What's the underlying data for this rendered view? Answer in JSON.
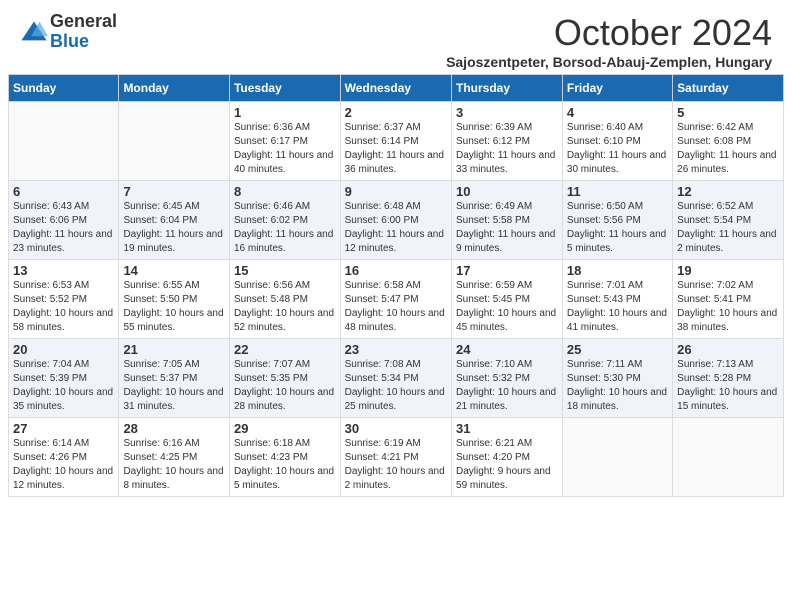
{
  "header": {
    "logo_general": "General",
    "logo_blue": "Blue",
    "month_title": "October 2024",
    "subtitle": "Sajoszentpeter, Borsod-Abauj-Zemplen, Hungary"
  },
  "days_of_week": [
    "Sunday",
    "Monday",
    "Tuesday",
    "Wednesday",
    "Thursday",
    "Friday",
    "Saturday"
  ],
  "weeks": [
    [
      {
        "day": "",
        "detail": ""
      },
      {
        "day": "",
        "detail": ""
      },
      {
        "day": "1",
        "detail": "Sunrise: 6:36 AM\nSunset: 6:17 PM\nDaylight: 11 hours and 40 minutes."
      },
      {
        "day": "2",
        "detail": "Sunrise: 6:37 AM\nSunset: 6:14 PM\nDaylight: 11 hours and 36 minutes."
      },
      {
        "day": "3",
        "detail": "Sunrise: 6:39 AM\nSunset: 6:12 PM\nDaylight: 11 hours and 33 minutes."
      },
      {
        "day": "4",
        "detail": "Sunrise: 6:40 AM\nSunset: 6:10 PM\nDaylight: 11 hours and 30 minutes."
      },
      {
        "day": "5",
        "detail": "Sunrise: 6:42 AM\nSunset: 6:08 PM\nDaylight: 11 hours and 26 minutes."
      }
    ],
    [
      {
        "day": "6",
        "detail": "Sunrise: 6:43 AM\nSunset: 6:06 PM\nDaylight: 11 hours and 23 minutes."
      },
      {
        "day": "7",
        "detail": "Sunrise: 6:45 AM\nSunset: 6:04 PM\nDaylight: 11 hours and 19 minutes."
      },
      {
        "day": "8",
        "detail": "Sunrise: 6:46 AM\nSunset: 6:02 PM\nDaylight: 11 hours and 16 minutes."
      },
      {
        "day": "9",
        "detail": "Sunrise: 6:48 AM\nSunset: 6:00 PM\nDaylight: 11 hours and 12 minutes."
      },
      {
        "day": "10",
        "detail": "Sunrise: 6:49 AM\nSunset: 5:58 PM\nDaylight: 11 hours and 9 minutes."
      },
      {
        "day": "11",
        "detail": "Sunrise: 6:50 AM\nSunset: 5:56 PM\nDaylight: 11 hours and 5 minutes."
      },
      {
        "day": "12",
        "detail": "Sunrise: 6:52 AM\nSunset: 5:54 PM\nDaylight: 11 hours and 2 minutes."
      }
    ],
    [
      {
        "day": "13",
        "detail": "Sunrise: 6:53 AM\nSunset: 5:52 PM\nDaylight: 10 hours and 58 minutes."
      },
      {
        "day": "14",
        "detail": "Sunrise: 6:55 AM\nSunset: 5:50 PM\nDaylight: 10 hours and 55 minutes."
      },
      {
        "day": "15",
        "detail": "Sunrise: 6:56 AM\nSunset: 5:48 PM\nDaylight: 10 hours and 52 minutes."
      },
      {
        "day": "16",
        "detail": "Sunrise: 6:58 AM\nSunset: 5:47 PM\nDaylight: 10 hours and 48 minutes."
      },
      {
        "day": "17",
        "detail": "Sunrise: 6:59 AM\nSunset: 5:45 PM\nDaylight: 10 hours and 45 minutes."
      },
      {
        "day": "18",
        "detail": "Sunrise: 7:01 AM\nSunset: 5:43 PM\nDaylight: 10 hours and 41 minutes."
      },
      {
        "day": "19",
        "detail": "Sunrise: 7:02 AM\nSunset: 5:41 PM\nDaylight: 10 hours and 38 minutes."
      }
    ],
    [
      {
        "day": "20",
        "detail": "Sunrise: 7:04 AM\nSunset: 5:39 PM\nDaylight: 10 hours and 35 minutes."
      },
      {
        "day": "21",
        "detail": "Sunrise: 7:05 AM\nSunset: 5:37 PM\nDaylight: 10 hours and 31 minutes."
      },
      {
        "day": "22",
        "detail": "Sunrise: 7:07 AM\nSunset: 5:35 PM\nDaylight: 10 hours and 28 minutes."
      },
      {
        "day": "23",
        "detail": "Sunrise: 7:08 AM\nSunset: 5:34 PM\nDaylight: 10 hours and 25 minutes."
      },
      {
        "day": "24",
        "detail": "Sunrise: 7:10 AM\nSunset: 5:32 PM\nDaylight: 10 hours and 21 minutes."
      },
      {
        "day": "25",
        "detail": "Sunrise: 7:11 AM\nSunset: 5:30 PM\nDaylight: 10 hours and 18 minutes."
      },
      {
        "day": "26",
        "detail": "Sunrise: 7:13 AM\nSunset: 5:28 PM\nDaylight: 10 hours and 15 minutes."
      }
    ],
    [
      {
        "day": "27",
        "detail": "Sunrise: 6:14 AM\nSunset: 4:26 PM\nDaylight: 10 hours and 12 minutes."
      },
      {
        "day": "28",
        "detail": "Sunrise: 6:16 AM\nSunset: 4:25 PM\nDaylight: 10 hours and 8 minutes."
      },
      {
        "day": "29",
        "detail": "Sunrise: 6:18 AM\nSunset: 4:23 PM\nDaylight: 10 hours and 5 minutes."
      },
      {
        "day": "30",
        "detail": "Sunrise: 6:19 AM\nSunset: 4:21 PM\nDaylight: 10 hours and 2 minutes."
      },
      {
        "day": "31",
        "detail": "Sunrise: 6:21 AM\nSunset: 4:20 PM\nDaylight: 9 hours and 59 minutes."
      },
      {
        "day": "",
        "detail": ""
      },
      {
        "day": "",
        "detail": ""
      }
    ]
  ]
}
